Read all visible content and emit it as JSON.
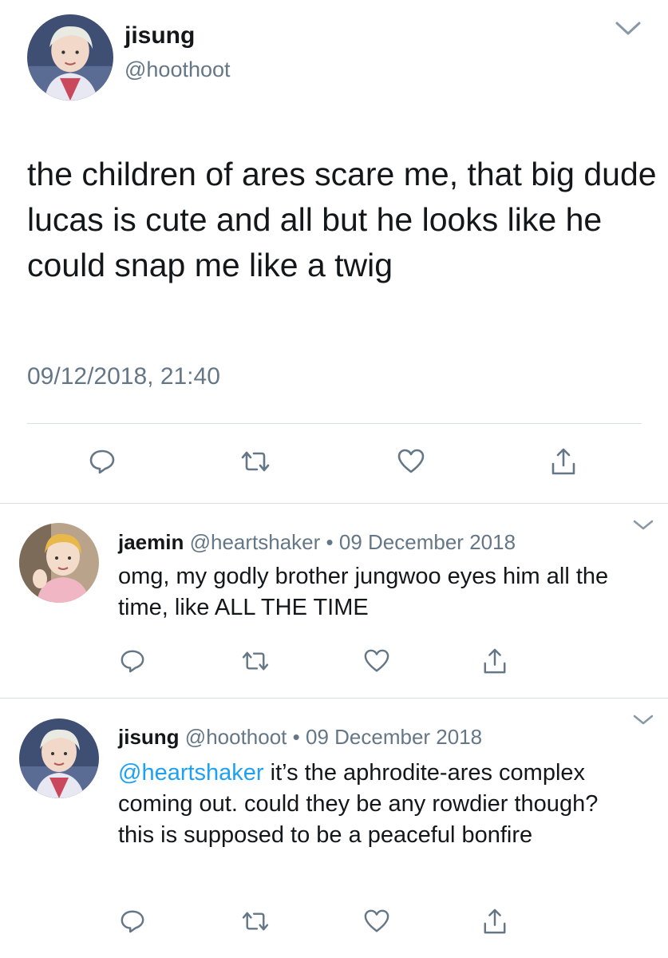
{
  "main_tweet": {
    "display_name": "jisung",
    "handle": "@hoothoot",
    "text": "the children of ares scare me, that big dude lucas is cute and all but he looks like he could snap me like a twig",
    "timestamp": "09/12/2018, 21:40",
    "avatar_icon": "avatar-jisung"
  },
  "replies": [
    {
      "display_name": "jaemin",
      "handle": "@heartshaker",
      "separator": "•",
      "date": "09 December 2018",
      "mention": "",
      "text": "omg, my godly brother jungwoo eyes him all the time, like ALL THE TIME",
      "avatar_icon": "avatar-jaemin"
    },
    {
      "display_name": "jisung",
      "handle": "@hoothoot",
      "separator": "•",
      "date": "09 December 2018",
      "mention": "@heartshaker",
      "text": " it’s the aphrodite-ares complex coming out. could they be any rowdier though? this is supposed to be a peaceful bonfire",
      "avatar_icon": "avatar-jisung"
    }
  ],
  "action_icons": [
    "reply-icon",
    "retweet-icon",
    "like-icon",
    "share-icon"
  ],
  "colors": {
    "text_primary": "#14171a",
    "text_secondary": "#657786",
    "link": "#1da1f2",
    "divider": "#d9dee3"
  }
}
